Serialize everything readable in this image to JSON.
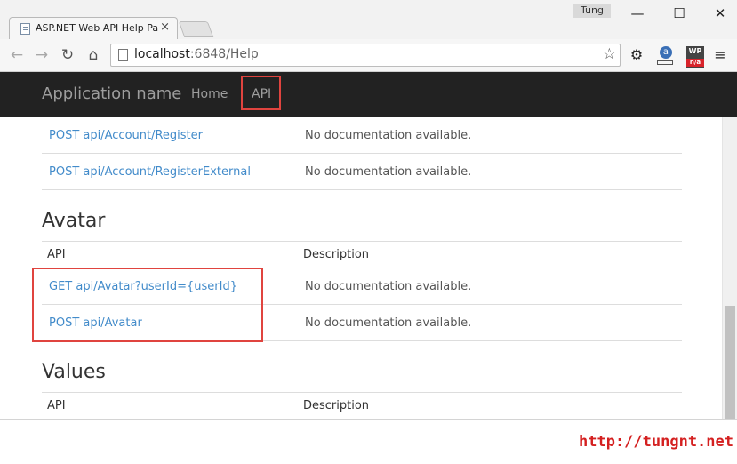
{
  "browser": {
    "tab_title": "ASP.NET Web API Help Pa",
    "tab_close": "×",
    "user": "Tung",
    "window_controls": {
      "minimize": "—",
      "maximize": "☐",
      "close": "✕"
    },
    "url_host": "localhost",
    "url_rest": ":6848/Help",
    "ext_wp_label": "WP",
    "ext_wp_badge": "n/a",
    "ext_a_label": "a",
    "icons": {
      "back": "back-arrow-icon",
      "forward": "forward-arrow-icon",
      "reload": "reload-icon",
      "home": "home-icon",
      "star": "star-icon",
      "settings": "gear-icon",
      "menu": "hamburger-menu-icon"
    }
  },
  "navbar": {
    "brand": "Application name",
    "links": [
      "Home",
      "API"
    ]
  },
  "content": {
    "account_rows": [
      {
        "api": "POST api/Account/Register",
        "description": "No documentation available."
      },
      {
        "api": "POST api/Account/RegisterExternal",
        "description": "No documentation available."
      }
    ],
    "avatar": {
      "title": "Avatar",
      "col_api": "API",
      "col_description": "Description",
      "rows": [
        {
          "api": "GET api/Avatar?userId={userId}",
          "description": "No documentation available."
        },
        {
          "api": "POST api/Avatar",
          "description": "No documentation available."
        }
      ]
    },
    "values": {
      "title": "Values",
      "col_api": "API",
      "col_description": "Description"
    }
  },
  "watermark": "http://tungnt.net",
  "colors": {
    "navbar_bg": "#222222",
    "link": "#428bca",
    "highlight": "#e0443f",
    "watermark": "#d42020"
  }
}
